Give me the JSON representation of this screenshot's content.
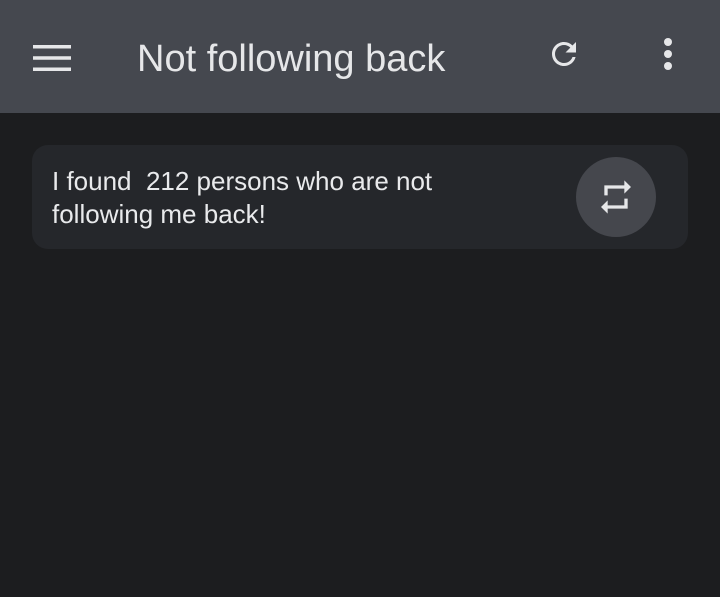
{
  "app_bar": {
    "title": "Not following back",
    "background_color": "#45484f",
    "icons": {
      "menu": "hamburger-menu-icon",
      "refresh": "refresh-icon",
      "more": "more-vertical-icon"
    }
  },
  "result_card": {
    "message_part1": "I found  212 persons who are not",
    "message_part2": "following me back!",
    "count": 212,
    "action_icon": "repeat-icon"
  },
  "colors": {
    "background": "#1c1d1f",
    "card": "#25272b",
    "text": "#e9eaec",
    "fab": "#45474d"
  }
}
